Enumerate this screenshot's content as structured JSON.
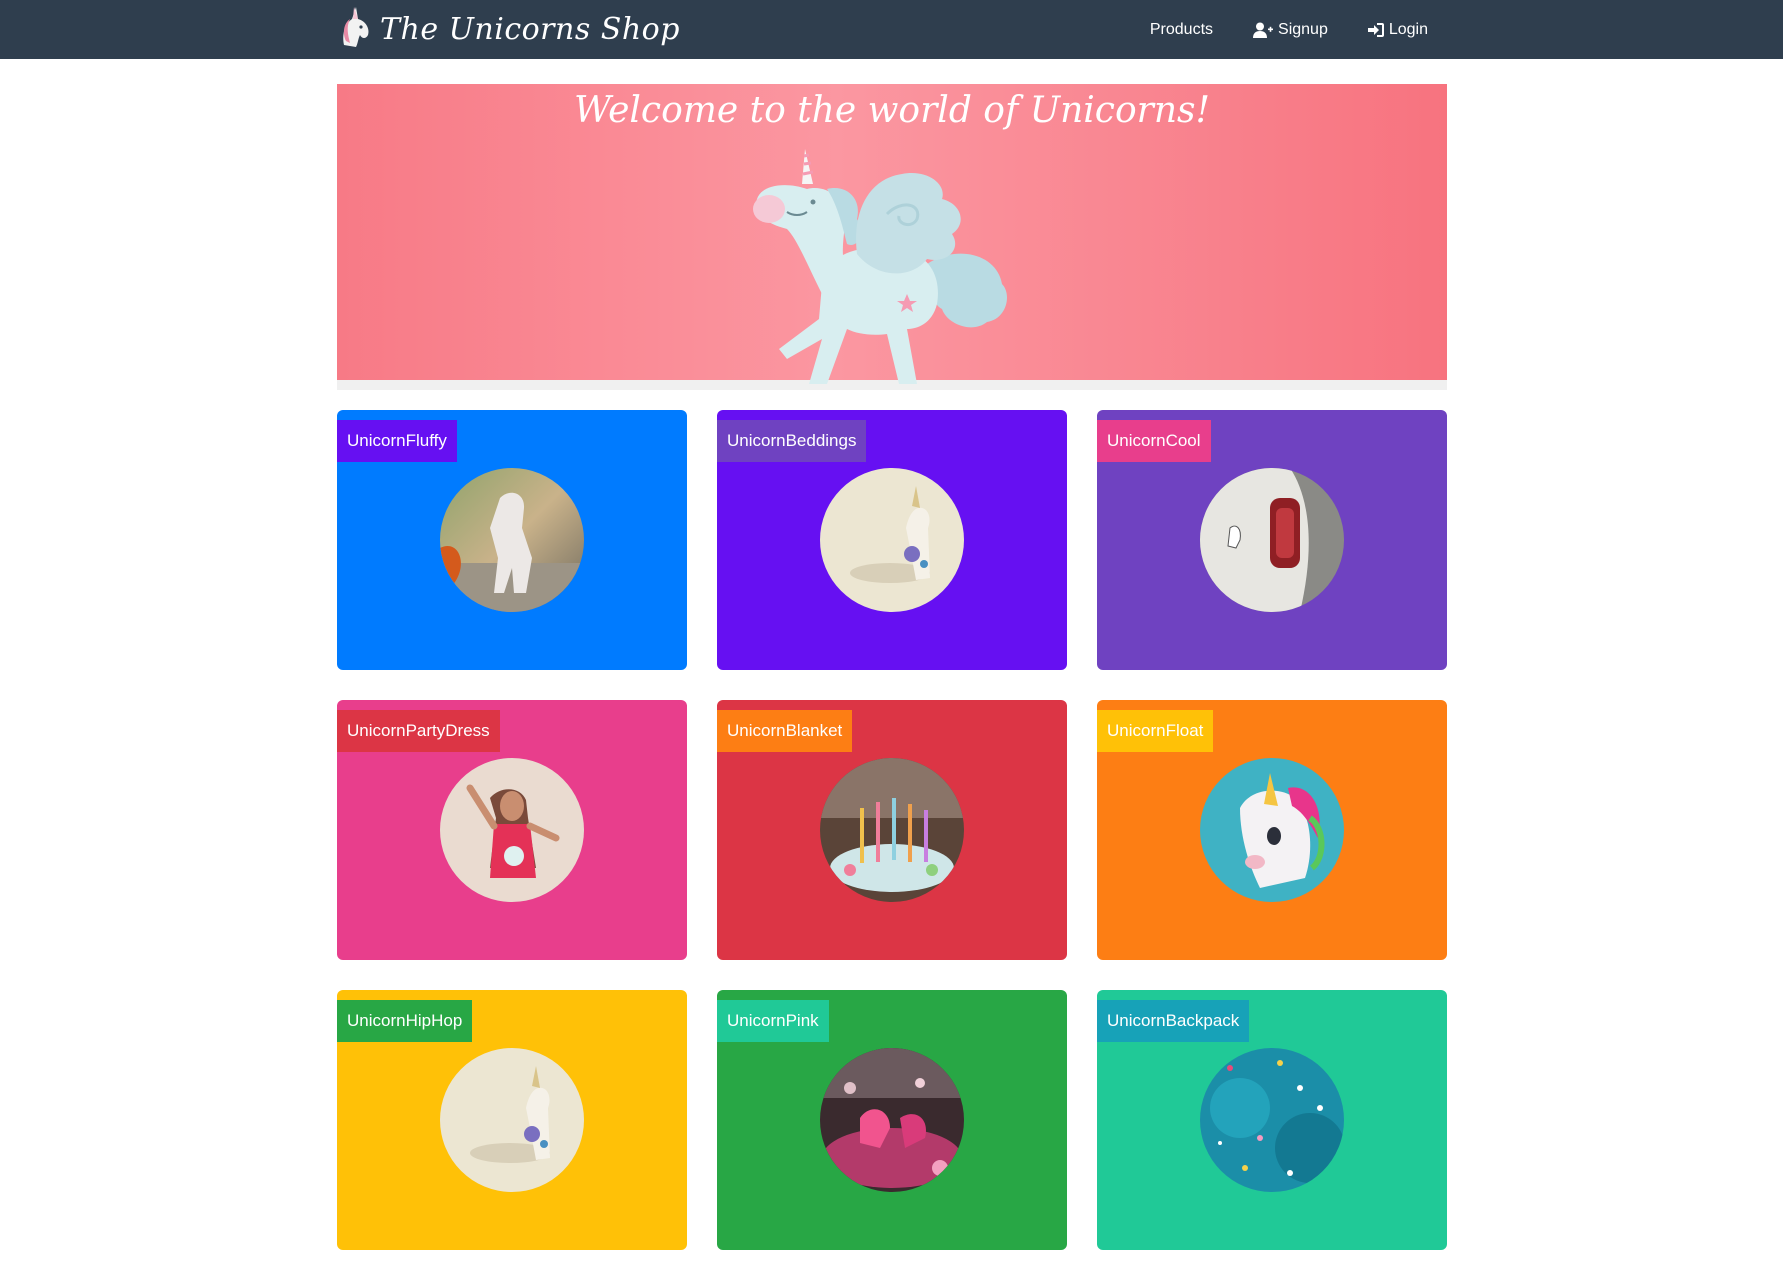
{
  "navbar": {
    "brand": "The Unicorns Shop",
    "links": [
      {
        "label": "Products",
        "icon": "none"
      },
      {
        "label": "Signup",
        "icon": "user-plus-icon"
      },
      {
        "label": "Login",
        "icon": "sign-in-icon"
      }
    ]
  },
  "hero": {
    "title": "Welcome to the world of Unicorns!"
  },
  "products": [
    {
      "name": "UnicornFluffy",
      "card_color": "#007bff",
      "label_color": "#6610f2"
    },
    {
      "name": "UnicornBeddings",
      "card_color": "#6610f2",
      "label_color": "#6f42c1"
    },
    {
      "name": "UnicornCool",
      "card_color": "#6f42c1",
      "label_color": "#e83e8c"
    },
    {
      "name": "UnicornPartyDress",
      "card_color": "#e83e8c",
      "label_color": "#dc3545"
    },
    {
      "name": "UnicornBlanket",
      "card_color": "#dc3545",
      "label_color": "#fd7e14"
    },
    {
      "name": "UnicornFloat",
      "card_color": "#fd7e14",
      "label_color": "#ffc107"
    },
    {
      "name": "UnicornHipHop",
      "card_color": "#ffc107",
      "label_color": "#28a745"
    },
    {
      "name": "UnicornPink",
      "card_color": "#28a745",
      "label_color": "#20c997"
    },
    {
      "name": "UnicornBackpack",
      "card_color": "#20c997",
      "label_color": "#17a2b8"
    }
  ]
}
